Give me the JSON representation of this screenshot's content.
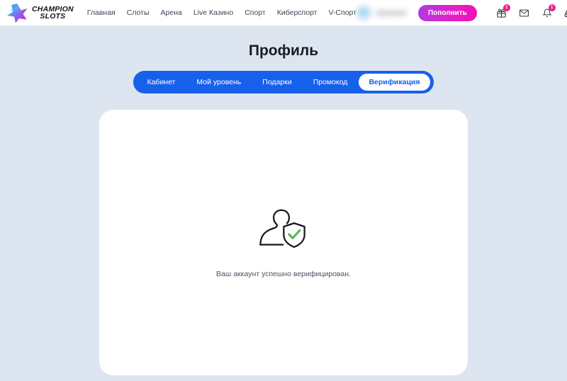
{
  "header": {
    "logo": {
      "name": "champion-slots-logo",
      "line1": "CHAMPION",
      "line2": "SLOTS",
      "gradient_from": "#18d3f0",
      "gradient_to": "#d61ae0"
    },
    "nav": [
      {
        "label": "Главная",
        "name": "nav-home"
      },
      {
        "label": "Слоты",
        "name": "nav-slots"
      },
      {
        "label": "Арена",
        "name": "nav-arena"
      },
      {
        "label": "Live Казино",
        "name": "nav-live-casino"
      },
      {
        "label": "Спорт",
        "name": "nav-sport"
      },
      {
        "label": "Киберспорт",
        "name": "nav-esport"
      },
      {
        "label": "V-Спорт",
        "name": "nav-vsport"
      }
    ],
    "topup_label": "Пополнить",
    "topup_color_from": "#b23ae0",
    "topup_color_to": "#ef12b5",
    "icons": {
      "gift": {
        "name": "gift-icon",
        "badge": "1"
      },
      "mail": {
        "name": "mail-icon",
        "badge": ""
      },
      "bell": {
        "name": "bell-icon",
        "badge": "1"
      },
      "support": {
        "name": "headset-icon",
        "badge": ""
      }
    },
    "badge_color": "#ec1e8a"
  },
  "main": {
    "page_title": "Профиль",
    "tabs": [
      {
        "label": "Кабинет",
        "name": "tab-kabinet",
        "active": false
      },
      {
        "label": "Мой уровень",
        "name": "tab-my-level",
        "active": false
      },
      {
        "label": "Подарки",
        "name": "tab-gifts",
        "active": false
      },
      {
        "label": "Промокод",
        "name": "tab-promocode",
        "active": false
      },
      {
        "label": "Верификация",
        "name": "tab-verification",
        "active": true
      }
    ],
    "tabs_bg_color": "#1760ea",
    "card": {
      "icon_name": "user-verified-shield-icon",
      "check_color": "#57b65a",
      "message": "Ваш аккаунт успешно верифицирован."
    }
  },
  "colors": {
    "page_background": "#dde6f0",
    "card_background": "#ffffff",
    "accent_blue": "#1760ea"
  }
}
